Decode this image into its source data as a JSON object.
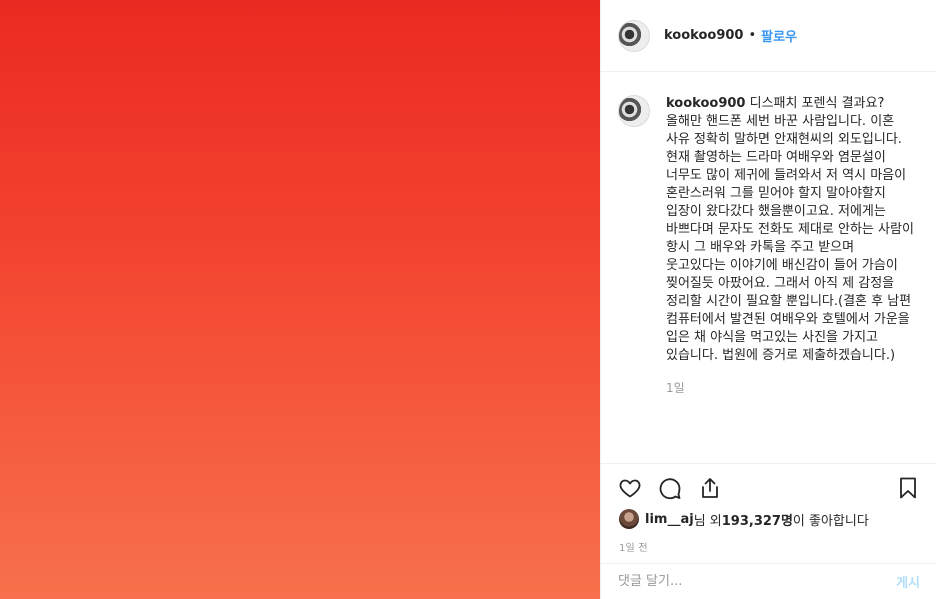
{
  "post": {
    "username": "kookoo900",
    "separator": "•",
    "follow_label": "팔로우",
    "caption_text": "디스패치 포렌식 결과요? 올해만 핸드폰 세번 바꾼 사람입니다. 이혼 사유 정확히 말하면 안재현씨의 외도입니다. 현재 촬영하는 드라마 여배우와 염문설이 너무도 많이 제귀에 들려와서 저 역시 마음이 혼란스러워 그를 믿어야 할지 말아야할지 입장이 왔다갔다 했을뿐이고요. 저에게는 바쁘다며 문자도 전화도 제대로 안하는 사람이 항시 그 배우와 카톡을 주고 받으며 웃고있다는 이야기에 배신감이 들어 가슴이 찢어질듯 아팠어요. 그래서 아직 제 감정을 정리할 시간이 필요할 뿐입니다.(결혼 후 남편 컴퓨터에서 발견된 여배우와 호텔에서 가운을 입은 채 야식을 먹고있는 사진을 가지고 있습니다. 법원에 증거로 제출하겠습니다.)",
    "caption_time": "1일",
    "likes": {
      "liker": "lim__aj",
      "middle": "님 외 ",
      "count": "193,327명",
      "suffix": "이 좋아합니다"
    },
    "posted_time": "1일 전",
    "comment_placeholder": "댓글 달기...",
    "post_button": "게시"
  },
  "icons": {
    "like": "heart-icon",
    "comment": "comment-icon",
    "share": "share-icon",
    "save": "bookmark-icon"
  },
  "colors": {
    "photo_top": "#ea2a22",
    "photo_bottom": "#f6714b",
    "follow": "#3897f0",
    "muted": "#999999"
  }
}
